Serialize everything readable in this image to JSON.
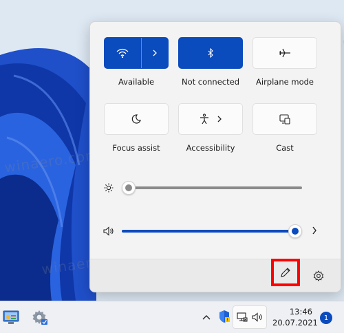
{
  "quick_settings": {
    "row1": [
      {
        "label": "Available",
        "icon": "wifi-icon",
        "active": true
      },
      {
        "label": "Not connected",
        "icon": "bluetooth-icon",
        "active": true
      },
      {
        "label": "Airplane mode",
        "icon": "airplane-icon",
        "active": false
      }
    ],
    "row2": [
      {
        "label": "Focus assist",
        "icon": "moon-icon",
        "active": false
      },
      {
        "label": "Accessibility",
        "icon": "accessibility-icon",
        "active": false
      },
      {
        "label": "Cast",
        "icon": "cast-icon",
        "active": false
      }
    ],
    "brightness": {
      "icon": "brightness-icon",
      "level": 0
    },
    "volume": {
      "icon": "speaker-icon",
      "level": 1.0
    }
  },
  "footer": {
    "edit_icon": "pencil-icon",
    "settings_icon": "gear-icon"
  },
  "taskbar": {
    "clock_time": "13:46",
    "clock_date": "20.07.2021",
    "notification_count": "1"
  },
  "watermark": "winaero.com",
  "colors": {
    "accent": "#0a4bbd",
    "highlight": "#ff0000"
  }
}
